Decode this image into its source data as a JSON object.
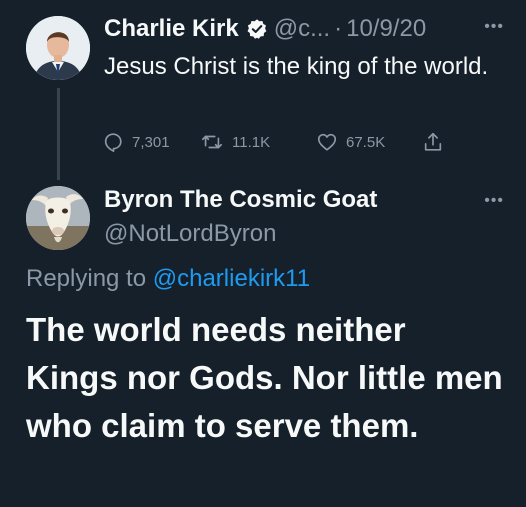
{
  "tweet": {
    "author_name": "Charlie Kirk",
    "handle": "@c...",
    "separator": "·",
    "date": "10/9/20",
    "text": "Jesus Christ is the king of the world.",
    "reply_count": "7,301",
    "retweet_count": "11.1K",
    "like_count": "67.5K",
    "more_icon": "more-dots-icon"
  },
  "reply": {
    "author_name": "Byron The Cosmic Goat",
    "handle": "@NotLordByron",
    "replying_prefix": "Replying to",
    "replying_mention": "@charliekirk11",
    "text": "The world needs neither Kings nor Gods. Nor little men who claim to serve them."
  },
  "colors": {
    "background": "#15202b",
    "primary_text": "#f7f9f9",
    "muted_text": "#8b98a5",
    "link": "#1d9bf0",
    "verified": "#f7f9f9"
  }
}
